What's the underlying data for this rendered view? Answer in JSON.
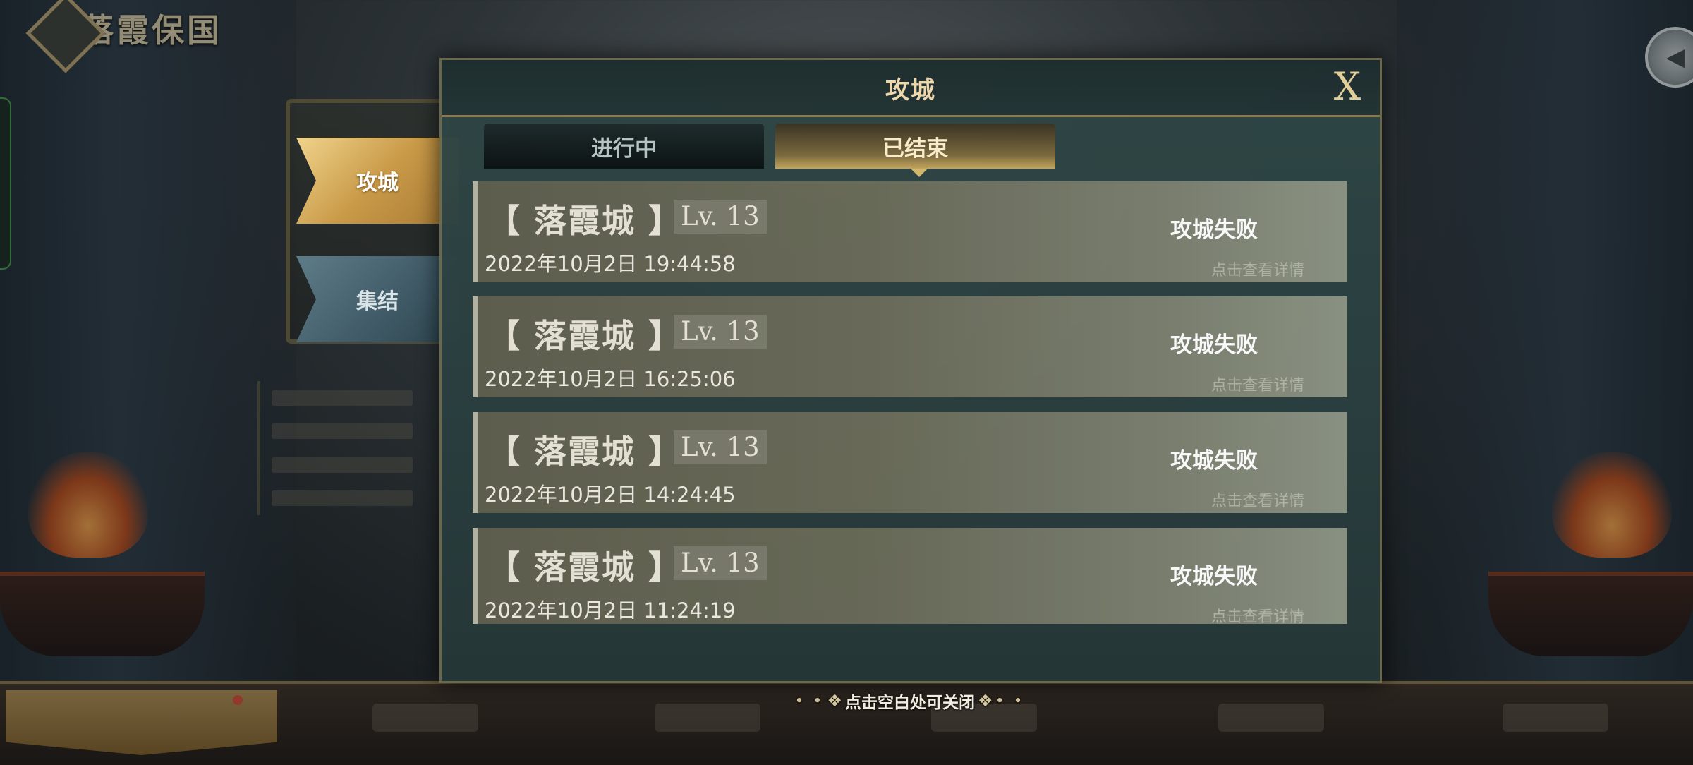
{
  "game": {
    "title": "落霞保国"
  },
  "side_tabs": [
    {
      "label": "攻城",
      "active": true
    },
    {
      "label": "集结",
      "active": false
    }
  ],
  "dialog": {
    "title": "攻城",
    "close_label": "X",
    "tabs": [
      {
        "label": "进行中",
        "active": false
      },
      {
        "label": "已结束",
        "active": true
      }
    ],
    "records": [
      {
        "name": "【 落霞城 】",
        "level": "Lv. 13",
        "time": "2022年10月2日  19:44:58",
        "status": "攻城失败",
        "detail": "点击查看详情"
      },
      {
        "name": "【 落霞城 】",
        "level": "Lv. 13",
        "time": "2022年10月2日  16:25:06",
        "status": "攻城失败",
        "detail": "点击查看详情"
      },
      {
        "name": "【 落霞城 】",
        "level": "Lv. 13",
        "time": "2022年10月2日  14:24:45",
        "status": "攻城失败",
        "detail": "点击查看详情"
      },
      {
        "name": "【 落霞城 】",
        "level": "Lv. 13",
        "time": "2022年10月2日  11:24:19",
        "status": "攻城失败",
        "detail": "点击查看详情"
      }
    ]
  },
  "close_hint": "点击空白处可关闭",
  "icons": {
    "back": "back-arrow-icon",
    "close": "close-icon",
    "ornament": "ornament-icon"
  },
  "colors": {
    "accent_gold": "#c99a48",
    "panel_teal": "#2f4746",
    "record_bg": "#6a6b59"
  }
}
